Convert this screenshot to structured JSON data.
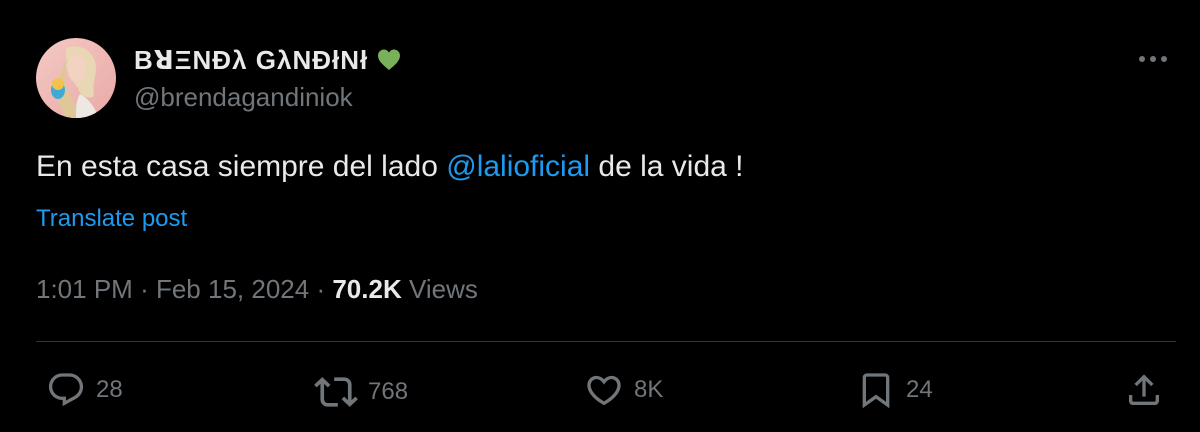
{
  "author": {
    "display_name": "BꓤΞNÐλ GλNÐłNł",
    "emoji": "green-heart",
    "handle": "@brendagandiniok"
  },
  "post": {
    "text_before": "En esta casa siempre del lado ",
    "mention": "@lalioficial",
    "text_after": " de la vida !",
    "translate_label": "Translate post",
    "time": "1:01 PM",
    "separator": "·",
    "date": "Feb 15, 2024",
    "views_count": "70.2K",
    "views_label": "Views"
  },
  "actions": {
    "replies": "28",
    "reposts": "768",
    "likes": "8K",
    "bookmarks": "24"
  },
  "colors": {
    "background": "#000000",
    "primary_text": "#e7e9ea",
    "secondary_text": "#71767b",
    "link": "#1d9bf0",
    "divider": "#2f3336",
    "heart": "#78b159"
  }
}
